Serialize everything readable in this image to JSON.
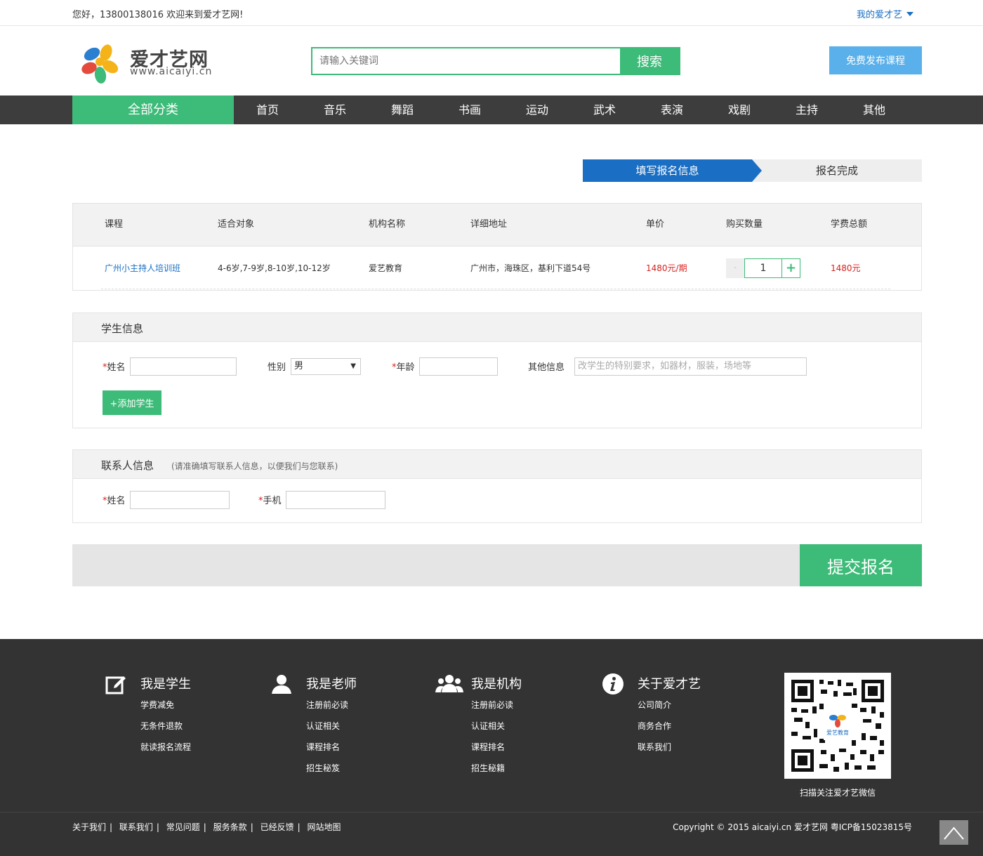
{
  "topbar": {
    "greeting": "您好，13800138016 欢迎来到爱才艺网!",
    "my_account": "我的爱才艺"
  },
  "header": {
    "logo_title": "爱才艺网",
    "logo_url": "www.aicaiyi.cn",
    "search_placeholder": "请输入关键词",
    "search_button": "搜索",
    "publish_button": "免费发布课程"
  },
  "nav": {
    "all_categories": "全部分类",
    "items": [
      "首页",
      "音乐",
      "舞蹈",
      "书画",
      "运动",
      "武术",
      "表演",
      "戏剧",
      "主持",
      "其他"
    ]
  },
  "steps": {
    "step1": "填写报名信息",
    "step2": "报名完成"
  },
  "course_table": {
    "headers": [
      "课程",
      "适合对象",
      "机构名称",
      "详细地址",
      "单价",
      "购买数量",
      "学费总额"
    ],
    "row": {
      "course": "广州小主持人培训班",
      "audience": "4-6岁,7-9岁,8-10岁,10-12岁",
      "org": "爱艺教育",
      "address": "广州市，海珠区，基利下道54号",
      "unit_price": "1480元/期",
      "quantity": "1",
      "minus": "-",
      "plus": "+",
      "total": "1480元"
    }
  },
  "student": {
    "title": "学生信息",
    "name_label": "姓名",
    "gender_label": "性别",
    "gender_value": "男",
    "age_label": "年龄",
    "other_label": "其他信息",
    "other_placeholder": "改学生的特别要求，如器材，服装，场地等",
    "add_button": "+添加学生",
    "required_mark": "*"
  },
  "contact": {
    "title": "联系人信息",
    "subtitle": "(请准确填写联系人信息，以便我们与您联系)",
    "name_label": "姓名",
    "phone_label": "手机",
    "required_mark": "*"
  },
  "submit": {
    "label": "提交报名"
  },
  "footer": {
    "columns": [
      {
        "title": "我是学生",
        "icon": "edit-icon",
        "links": [
          "学费减免",
          "无条件退款",
          "就读报名流程"
        ]
      },
      {
        "title": "我是老师",
        "icon": "user-icon",
        "links": [
          "注册前必读",
          "认证相关",
          "课程排名",
          "招生秘笈"
        ]
      },
      {
        "title": "我是机构",
        "icon": "group-icon",
        "links": [
          "注册前必读",
          "认证相关",
          "课程排名",
          "招生秘籍"
        ]
      },
      {
        "title": "关于爱才艺",
        "icon": "info-icon",
        "links": [
          "公司简介",
          "商务合作",
          "联系我们"
        ]
      }
    ],
    "qr_caption": "扫描关注爱才艺微信",
    "qr_label": "爱艺教育",
    "bottom_links": [
      "关于我们",
      "联系我们",
      "常见问题",
      "服务条款",
      "已经反馈",
      "网站地图"
    ],
    "copyright": "Copyright © 2015 aicaiyi.cn 爱才艺网 粤ICP备15023815号"
  },
  "colors": {
    "green": "#3dbb78",
    "blue": "#1a6fc4",
    "red": "#d6221e",
    "dark": "#333333",
    "nav": "#3d3d3d",
    "light_blue": "#5ab0ea"
  }
}
